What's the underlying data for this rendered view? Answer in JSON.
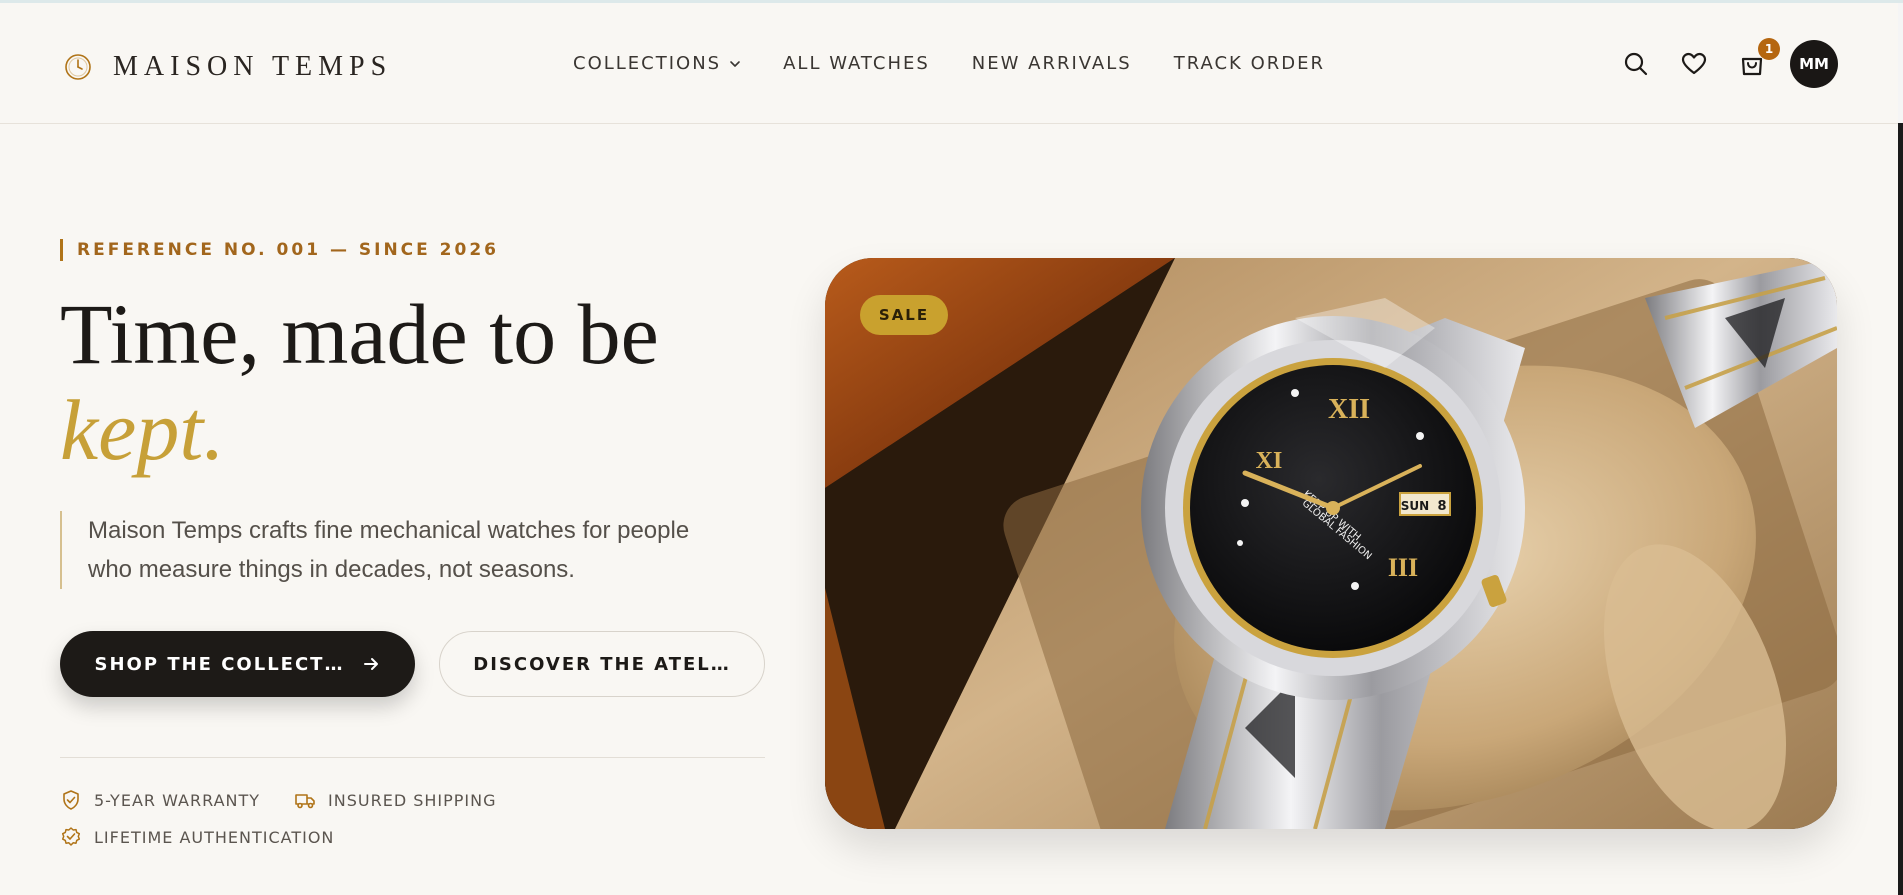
{
  "brand": {
    "name": "MAISON TEMPS",
    "logo_icon": "clock-icon",
    "accent_color": "#b07418"
  },
  "nav": {
    "items": [
      {
        "label": "COLLECTIONS",
        "has_dropdown": true
      },
      {
        "label": "ALL WATCHES"
      },
      {
        "label": "NEW ARRIVALS"
      },
      {
        "label": "TRACK ORDER"
      }
    ]
  },
  "actions": {
    "search_icon": "search-icon",
    "wishlist_icon": "heart-icon",
    "cart_icon": "shopping-bag-icon",
    "cart_count": "1",
    "avatar_initials": "MM"
  },
  "hero": {
    "eyebrow": "REFERENCE NO. 001 — SINCE 2026",
    "headline_line1": "Time, made to be",
    "headline_line2": "kept.",
    "lede": "Maison Temps crafts fine mechanical watches for people who measure things in decades, not seasons.",
    "primary_cta": "SHOP THE COLLECT…",
    "secondary_cta": "DISCOVER THE ATEL…",
    "badge": "SALE",
    "trust": [
      {
        "icon": "shield-check-icon",
        "label": "5-YEAR WARRANTY"
      },
      {
        "icon": "truck-icon",
        "label": "INSURED SHIPPING"
      },
      {
        "icon": "badge-check-icon",
        "label": "LIFETIME AUTHENTICATION"
      }
    ]
  },
  "watch_dial": {
    "numeral_xii": "XII",
    "numeral_xi": "XI",
    "numeral_iii": "III",
    "day": "SUN",
    "date": "8",
    "slogan_line1": "KEEP UP WITH",
    "slogan_line2": "GLOBAL FASHION"
  }
}
